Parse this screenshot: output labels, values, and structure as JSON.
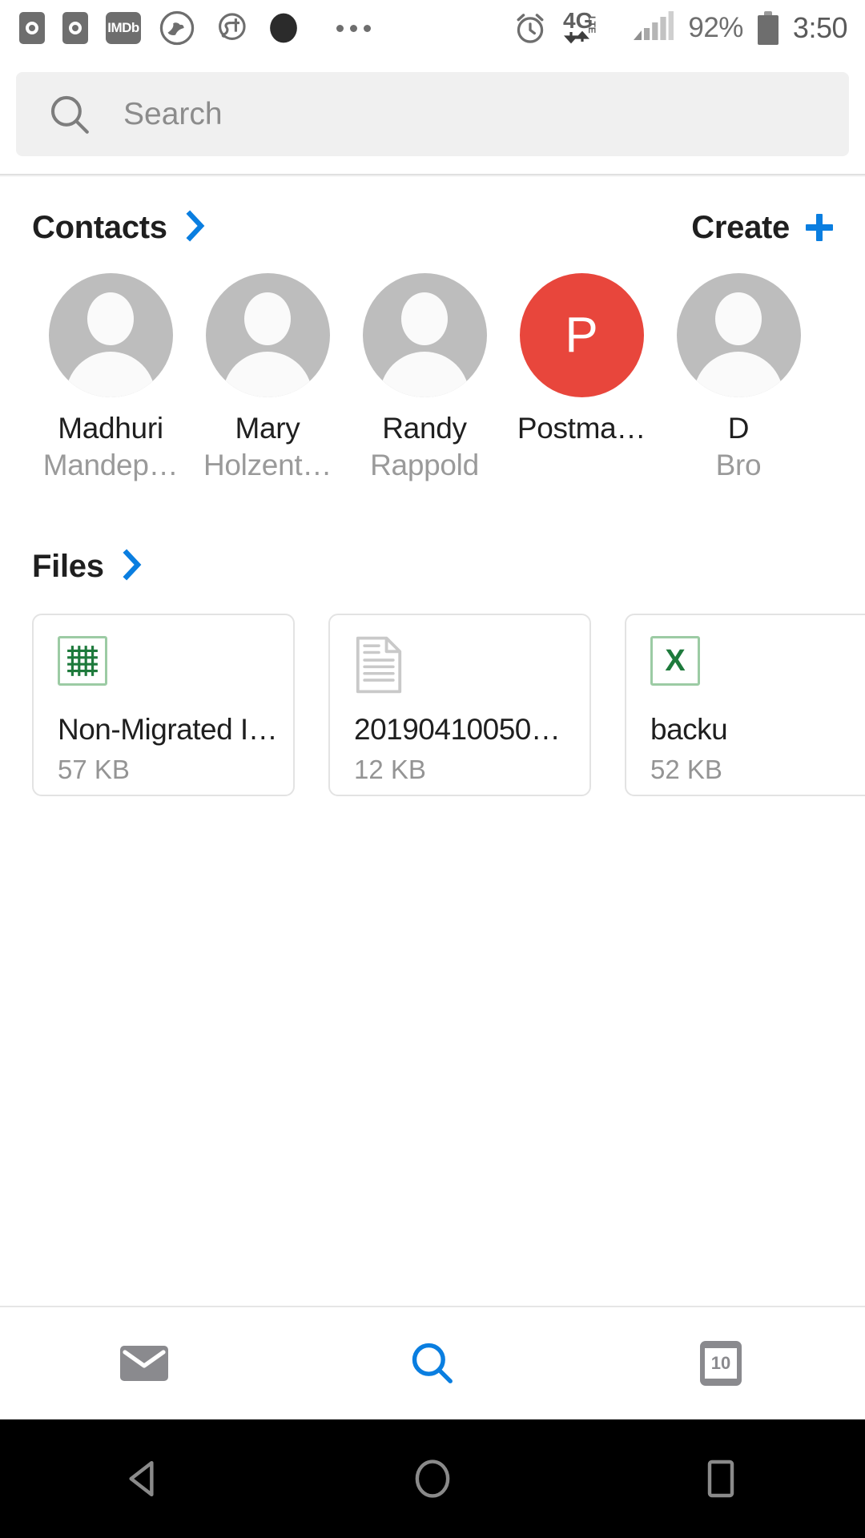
{
  "statusbar": {
    "left_icons": [
      {
        "name": "app-badge-circle-icon",
        "label": ""
      },
      {
        "name": "app-badge-circle-icon-2",
        "label": ""
      },
      {
        "name": "imdb-icon",
        "label": "IMDb"
      },
      {
        "name": "app-globe-icon",
        "label": ""
      },
      {
        "name": "app-st-icon",
        "label": ""
      },
      {
        "name": "app-dot-icon",
        "label": ""
      }
    ],
    "overflow_icon": "more-dots-icon",
    "alarm_icon": "alarm-clock-icon",
    "network_label": "4G",
    "network_sub": "LTE",
    "signal_icon": "signal-bars-icon",
    "battery_percent": "92%",
    "battery_icon": "battery-full-icon",
    "clock": "3:50"
  },
  "search": {
    "icon": "search-icon",
    "placeholder": "Search",
    "value": ""
  },
  "contacts_section": {
    "title": "Contacts",
    "chevron_icon": "chevron-right-icon",
    "create_label": "Create",
    "create_icon": "plus-icon",
    "items": [
      {
        "first": "Madhuri",
        "last": "Mandep…",
        "avatar_type": "person",
        "initial": "",
        "color": "#bdbdbd"
      },
      {
        "first": "Mary",
        "last": "Holzent…",
        "avatar_type": "person",
        "initial": "",
        "color": "#bdbdbd"
      },
      {
        "first": "Randy",
        "last": "Rappold",
        "avatar_type": "person",
        "initial": "",
        "color": "#bdbdbd"
      },
      {
        "first": "Postma…",
        "last": "",
        "avatar_type": "initial",
        "initial": "P",
        "color": "#e8463c"
      },
      {
        "first": "D",
        "last": "Bro",
        "avatar_type": "person",
        "initial": "",
        "color": "#bdbdbd"
      }
    ]
  },
  "files_section": {
    "title": "Files",
    "chevron_icon": "chevron-right-icon",
    "items": [
      {
        "name": "Non-Migrated I…",
        "size": "57 KB",
        "icon": "spreadsheet-grid-icon",
        "icon_glyph": ""
      },
      {
        "name": "20190410050…",
        "size": "12 KB",
        "icon": "document-icon",
        "icon_glyph": ""
      },
      {
        "name": "backu",
        "size": "52 KB",
        "icon": "excel-icon",
        "icon_glyph": "X"
      }
    ]
  },
  "bottom_nav": {
    "items": [
      {
        "name": "mail-icon",
        "label": "",
        "active": false
      },
      {
        "name": "search-icon",
        "label": "",
        "active": true
      },
      {
        "name": "calendar-icon",
        "label": "10",
        "active": false
      }
    ]
  },
  "android_nav": {
    "back_icon": "back-triangle-icon",
    "home_icon": "home-circle-icon",
    "recents_icon": "recents-square-icon"
  },
  "colors": {
    "accent_blue": "#0a7ee0",
    "avatar_red": "#e8463c",
    "excel_green": "#1e7a3c",
    "muted_gray": "#9a9a9a"
  }
}
